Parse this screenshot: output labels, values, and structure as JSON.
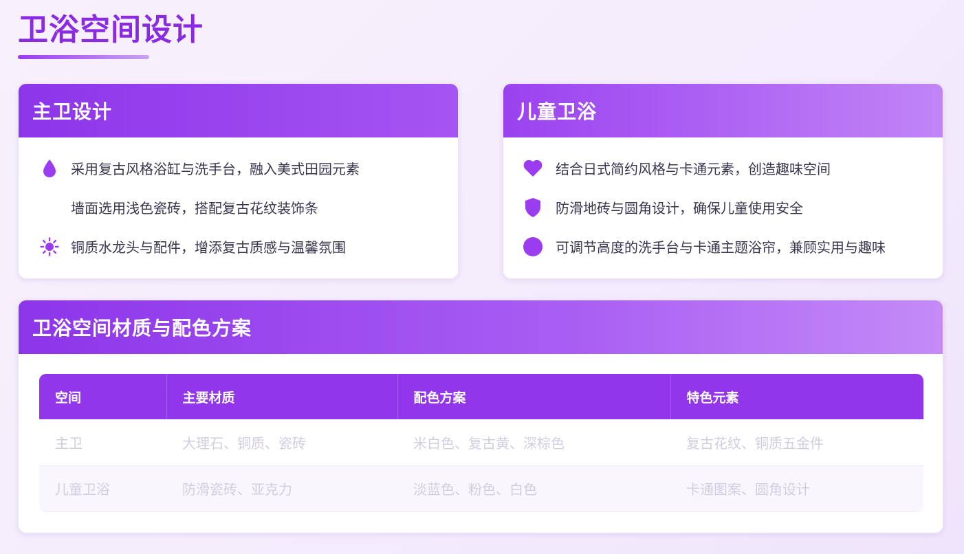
{
  "page": {
    "title": "卫浴空间设计"
  },
  "master_bath": {
    "title": "主卫设计",
    "items": [
      {
        "icon": "water-drop-icon",
        "text": "采用复古风格浴缸与洗手台，融入美式田园元素"
      },
      {
        "icon": "",
        "text": "墙面选用浅色瓷砖，搭配复古花纹装饰条"
      },
      {
        "icon": "sun-icon",
        "text": "铜质水龙头与配件，增添复古质感与温馨氛围"
      }
    ]
  },
  "kids_bath": {
    "title": "儿童卫浴",
    "items": [
      {
        "icon": "heart-icon",
        "text": "结合日式简约风格与卡通元素，创造趣味空间"
      },
      {
        "icon": "shield-icon",
        "text": "防滑地砖与圆角设计，确保儿童使用安全"
      },
      {
        "icon": "circle-icon",
        "text": "可调节高度的洗手台与卡通主题浴帘，兼顾实用与趣味"
      }
    ]
  },
  "materials": {
    "title": "卫浴空间材质与配色方案",
    "headers": [
      "空间",
      "主要材质",
      "配色方案",
      "特色元素"
    ],
    "rows": [
      [
        "主卫",
        "大理石、铜质、瓷砖",
        "米白色、复古黄、深棕色",
        "复古花纹、铜质五金件"
      ],
      [
        "儿童卫浴",
        "防滑瓷砖、亚克力",
        "淡蓝色、粉色、白色",
        "卡通图案、圆角设计"
      ]
    ]
  },
  "colors": {
    "accent": "#8a2be2",
    "header": "#9136ea",
    "icon": "#9b3cf0"
  }
}
